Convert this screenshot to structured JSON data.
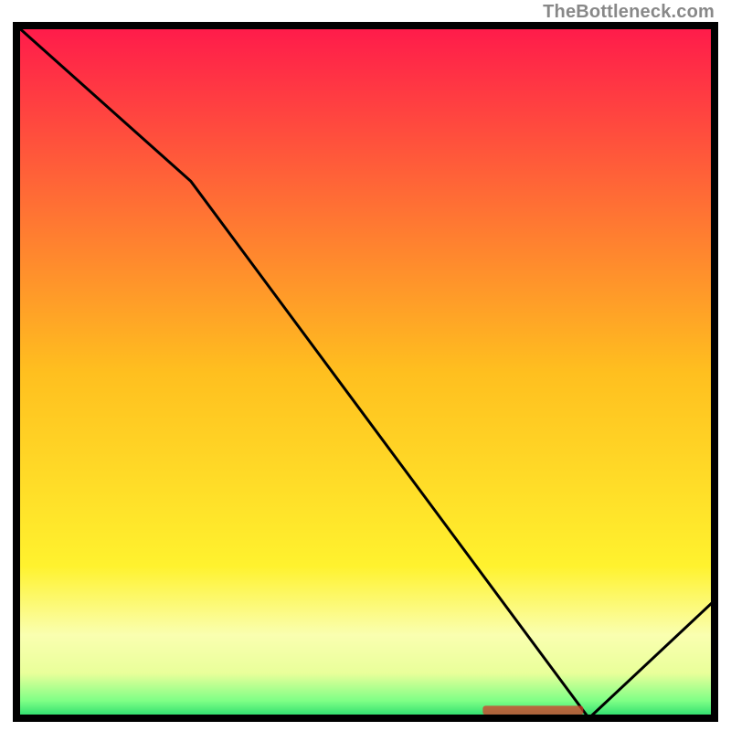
{
  "attribution": "TheBottleneck.com",
  "chart_data": {
    "type": "line",
    "title": "",
    "xlabel": "",
    "ylabel": "",
    "xlim": [
      0,
      100
    ],
    "ylim": [
      0,
      100
    ],
    "x": [
      0,
      25,
      82,
      100
    ],
    "values": [
      100,
      77.5,
      0,
      17
    ],
    "annotations": [
      {
        "text": "",
        "x": 74,
        "y": 1,
        "color": "#d43a2a"
      }
    ],
    "background_gradient": {
      "stops": [
        {
          "offset": 0.0,
          "color": "#ff1a4b"
        },
        {
          "offset": 0.5,
          "color": "#ffbf1f"
        },
        {
          "offset": 0.78,
          "color": "#fff22e"
        },
        {
          "offset": 0.88,
          "color": "#faffb0"
        },
        {
          "offset": 0.935,
          "color": "#e9ff9a"
        },
        {
          "offset": 0.975,
          "color": "#7eff86"
        },
        {
          "offset": 1.0,
          "color": "#22d96b"
        }
      ]
    },
    "frame": {
      "stroke": "#000000",
      "width": 8
    }
  }
}
